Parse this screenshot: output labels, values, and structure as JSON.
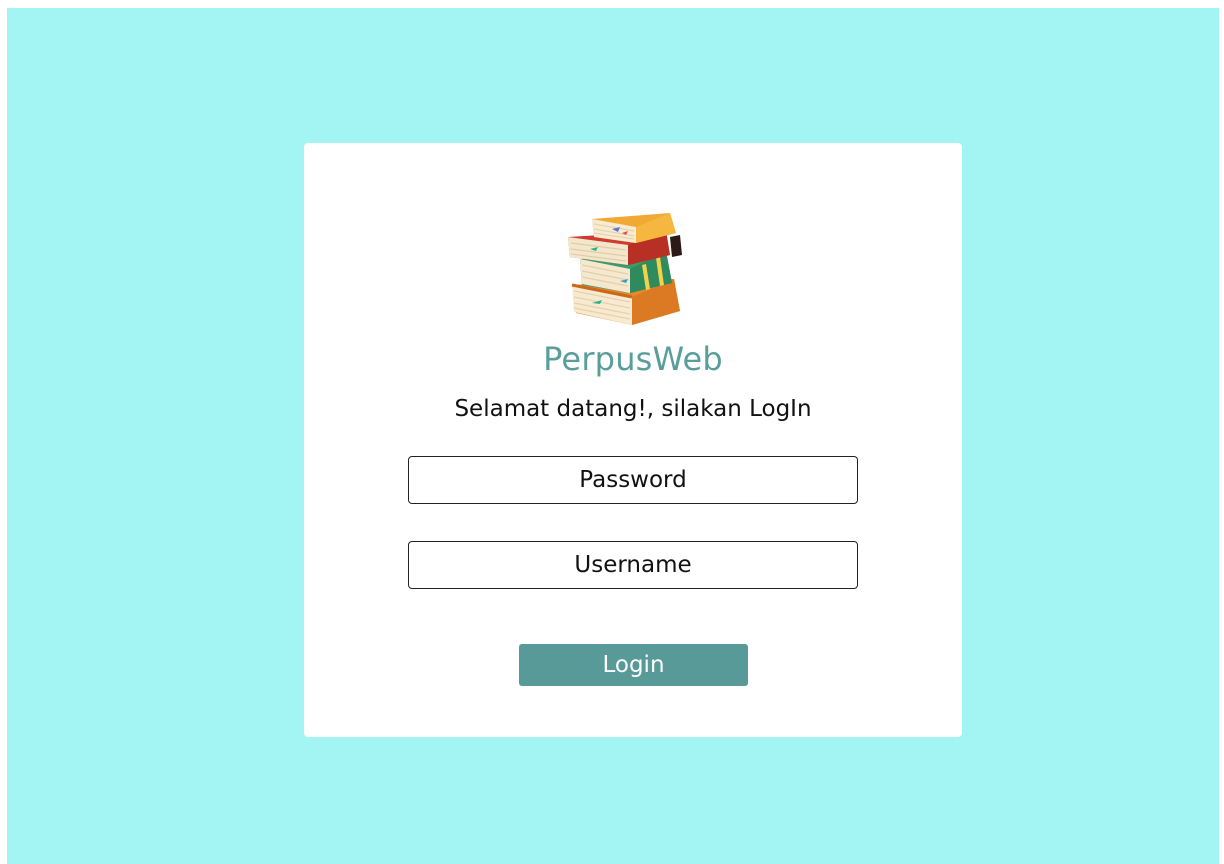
{
  "app": {
    "title": "PerpusWeb",
    "welcome": "Selamat datang!, silakan LogIn"
  },
  "form": {
    "password_placeholder": "Password",
    "username_placeholder": "Username",
    "login_label": "Login"
  },
  "logo": {
    "icon": "books-stack-icon"
  },
  "colors": {
    "background": "#a2f5f2",
    "card": "#ffffff",
    "title": "#5a9e9b",
    "button": "#579a97",
    "button_text": "#ffffff"
  }
}
